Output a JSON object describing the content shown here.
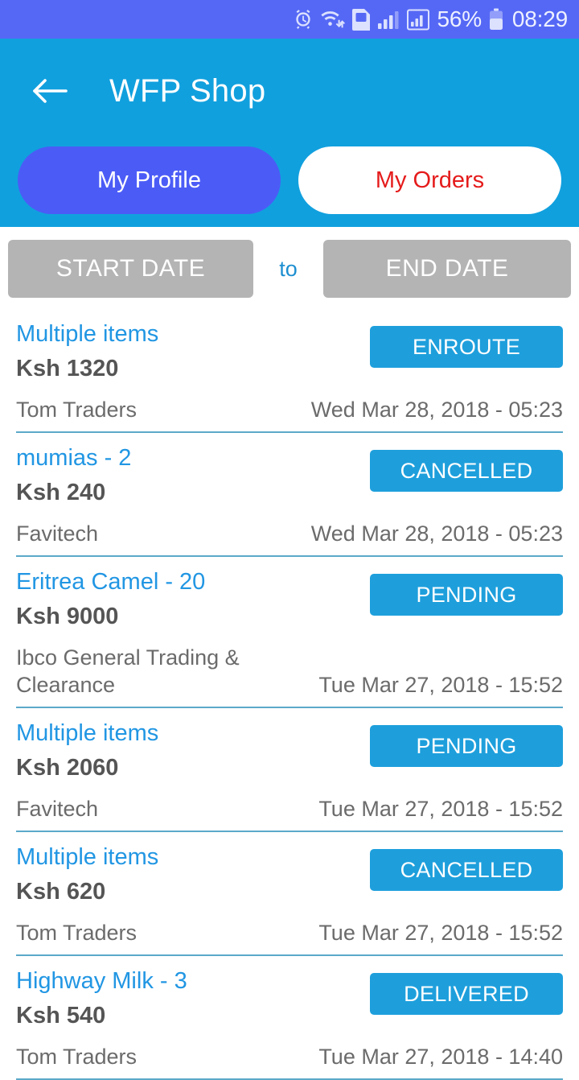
{
  "status_bar": {
    "icons": [
      "alarm-icon",
      "wifi-icon",
      "sim-card-icon",
      "signal-bars-icon",
      "signal-strength-icon"
    ],
    "battery_percent": "56%",
    "time": "08:29",
    "background_color": "#5568F5"
  },
  "header": {
    "title": "WFP Shop",
    "back_icon": "back-arrow-icon",
    "background_color": "#11A0DE",
    "tabs": [
      {
        "label": "My Profile",
        "active": true,
        "bg": "#4B5CF6",
        "fg": "#FFFFFF"
      },
      {
        "label": "My Orders",
        "active": false,
        "bg": "#FFFFFF",
        "fg": "#E51B1B"
      }
    ]
  },
  "date_filter": {
    "start_label": "START DATE",
    "separator": "to",
    "end_label": "END DATE",
    "button_color": "#B4B4B4",
    "separator_color": "#1E8FD0"
  },
  "orders": [
    {
      "title": "Multiple items",
      "price": "Ksh 1320",
      "vendor": "Tom Traders",
      "date": "Wed Mar 28, 2018 - 05:23",
      "status": "ENROUTE"
    },
    {
      "title": "mumias - 2",
      "price": "Ksh 240",
      "vendor": "Favitech",
      "date": "Wed Mar 28, 2018 - 05:23",
      "status": "CANCELLED"
    },
    {
      "title": "Eritrea Camel - 20",
      "price": "Ksh 9000",
      "vendor": "Ibco General Trading & Clearance",
      "date": "Tue Mar 27, 2018 - 15:52",
      "status": "PENDING"
    },
    {
      "title": "Multiple items",
      "price": "Ksh 2060",
      "vendor": "Favitech",
      "date": "Tue Mar 27, 2018 - 15:52",
      "status": "PENDING"
    },
    {
      "title": "Multiple items",
      "price": "Ksh 620",
      "vendor": "Tom Traders",
      "date": "Tue Mar 27, 2018 - 15:52",
      "status": "CANCELLED"
    },
    {
      "title": "Highway Milk - 3",
      "price": "Ksh 540",
      "vendor": "Tom Traders",
      "date": "Tue Mar 27, 2018 - 14:40",
      "status": "DELIVERED"
    }
  ],
  "colors": {
    "accent_blue": "#11A0DE",
    "badge_blue": "#1E9FDC",
    "link_blue": "#2196E3",
    "divider": "#5BA9C9",
    "tab_indigo": "#4B5CF6",
    "tab_red": "#E51B1B"
  }
}
